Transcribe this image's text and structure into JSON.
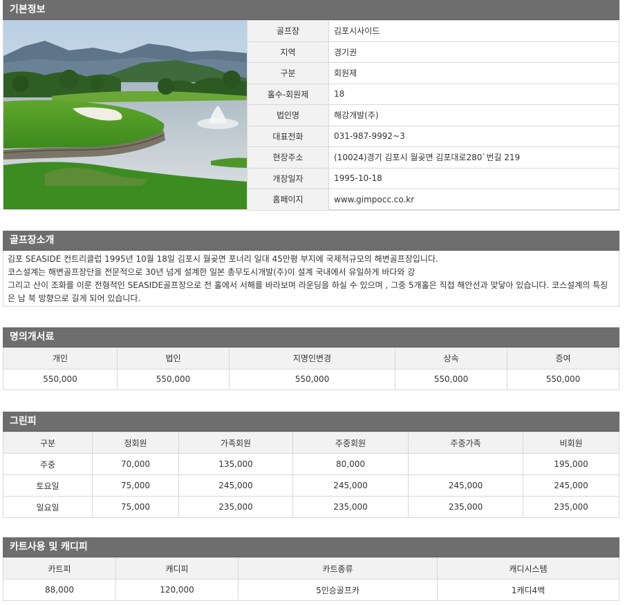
{
  "basic": {
    "title": "기본정보",
    "fields": [
      {
        "label": "골프장",
        "value": "김포시사이드"
      },
      {
        "label": "지역",
        "value": "경기권"
      },
      {
        "label": "구분",
        "value": "회원제"
      },
      {
        "label": "홀수-회원제",
        "value": "18"
      },
      {
        "label": "법인명",
        "value": "해강개발(주)"
      },
      {
        "label": "대표전화",
        "value": "031-987-9992~3"
      },
      {
        "label": "현장주소",
        "value": "(10024)경기 김포시 월곶면 김포대로280`번길 219"
      },
      {
        "label": "개장일자",
        "value": "1995-10-18"
      },
      {
        "label": "홈페이지",
        "value": "www.gimpocc.co.kr"
      }
    ]
  },
  "intro": {
    "title": "골프장소개",
    "lines": [
      "김포 SEASIDE 컨트리클럽 1995년 10월 18일 김포시 월곶면 포너리 일대 45만평 부지에 국제적규모의 해변골프장입니다.",
      "코스설계는 해변골프장단을 전문적으로 30년 넘게 설계한 일본 총무도시개발(주)이 설계 국내에서 유일하게 바다와 강",
      "그리고 산이 조화를 이룬 전형적인 SEASIDE골프장으로 전 홀에서 서해를 바라보며 라운딩을 하실 수 있으며 , 그중 5개홀은 직접 해안선과 맞닿아 있습니다. 코스설계의 특징은 남 북 방향으로 길게 되어 있습니다."
    ]
  },
  "transfer": {
    "title": "명의개서료",
    "headers": [
      "개인",
      "법인",
      "지명인변경",
      "상속",
      "증여"
    ],
    "values": [
      "550,000",
      "550,000",
      "550,000",
      "550,000",
      "550,000"
    ]
  },
  "greenfee": {
    "title": "그린피",
    "headers": [
      "구분",
      "정회원",
      "가족회원",
      "주중회원",
      "주중가족",
      "비회원"
    ],
    "rows": [
      [
        "주중",
        "70,000",
        "135,000",
        "80,000",
        "",
        "195,000"
      ],
      [
        "토요일",
        "75,000",
        "245,000",
        "245,000",
        "245,000",
        "245,000"
      ],
      [
        "일요일",
        "75,000",
        "235,000",
        "235,000",
        "235,000",
        "235,000"
      ]
    ]
  },
  "cart": {
    "title": "카트사용 및 캐디피",
    "headers": [
      "카트피",
      "캐디피",
      "카트종류",
      "캐디시스템"
    ],
    "values": [
      "88,000",
      "120,000",
      "5인승골프카",
      "1캐디4백"
    ]
  },
  "colors": {
    "header_bg": "#6e6e6e",
    "label_bg": "#f2f2f2",
    "border": "#d8d8d8"
  }
}
